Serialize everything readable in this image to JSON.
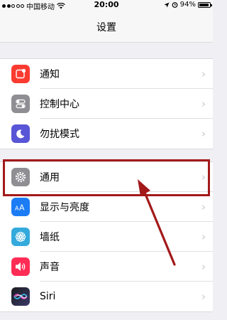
{
  "status_bar": {
    "carrier": "中国移动",
    "time": "20:00",
    "battery": "94%",
    "battery_level": 0.94
  },
  "nav": {
    "title": "设置"
  },
  "groups": [
    {
      "items": [
        {
          "label": "通知",
          "icon": "notification-icon",
          "color": "#fb3b30"
        },
        {
          "label": "控制中心",
          "icon": "control-center-icon",
          "color": "#8e8e93"
        },
        {
          "label": "勿扰模式",
          "icon": "moon-icon",
          "color": "#5856d6"
        }
      ]
    },
    {
      "items": [
        {
          "label": "通用",
          "icon": "gear-icon",
          "color": "#8e8e93"
        },
        {
          "label": "显示与亮度",
          "icon": "display-icon",
          "color": "#1b7cf5"
        },
        {
          "label": "墙纸",
          "icon": "wallpaper-icon",
          "color": "#34aadc"
        },
        {
          "label": "声音",
          "icon": "speaker-icon",
          "color": "#ff2d55"
        },
        {
          "label": "Siri",
          "icon": "siri-icon",
          "color": "#222"
        }
      ]
    }
  ],
  "chevron": "›",
  "highlight_color": "#a3191a"
}
